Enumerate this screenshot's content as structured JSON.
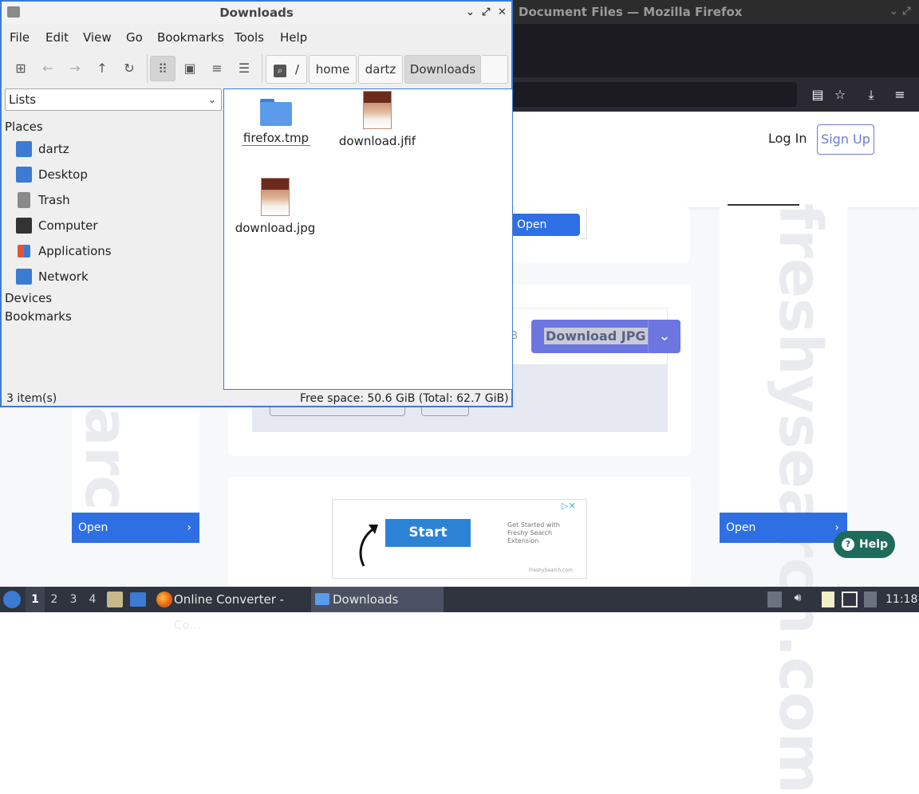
{
  "firefox": {
    "window_title": "Document Files — Mozilla Firefox",
    "controls": {
      "minimize": "⌄",
      "maximize": "⤢",
      "close": "✕"
    },
    "toolbar_icons": [
      "reader-view-icon",
      "bookmark-star-icon",
      "downloads-icon",
      "menu-icon"
    ],
    "toolbar_glyphs": {
      "reader": "▤",
      "star": "☆",
      "download": "⤓",
      "menu": "≡"
    },
    "header": {
      "login": "Log In",
      "signup": "Sign Up"
    },
    "converter": {
      "download_label": "Download JPG",
      "dropdown_glyph": "⌄",
      "size_fragment": "B"
    },
    "open_buttons": {
      "label": "Open",
      "chevron": "›"
    },
    "freshy_ad": {
      "start": "Start",
      "text": "Get Started with Freshy Search Extension",
      "url": "FreshySearch.com",
      "close": "▷✕"
    },
    "watermark": "freshysearch.com",
    "watermark_left": "arch.com",
    "help": {
      "label": "Help",
      "glyph": "?"
    }
  },
  "file_manager": {
    "title": "Downloads",
    "controls": {
      "minimize": "⌄",
      "maximize": "⤢",
      "close": "✕"
    },
    "menu": [
      "File",
      "Edit",
      "View",
      "Go",
      "Bookmarks",
      "Tools",
      "Help"
    ],
    "toolbar": {
      "new_tab": "⊞",
      "back": "←",
      "forward": "→",
      "up": "↑",
      "reload": "↻",
      "icon_view": "⠿",
      "thumb_view": "▣",
      "compact_view": "≡",
      "list_view": "☰"
    },
    "breadcrumbs": {
      "root_glyph": "⌕",
      "root": "/",
      "items": [
        "home",
        "dartz",
        "Downloads"
      ]
    },
    "sidebar": {
      "selector": "Lists",
      "places_header": "Places",
      "places": [
        {
          "label": "dartz",
          "icon": "home-folder-icon",
          "color": "#3b7bd4"
        },
        {
          "label": "Desktop",
          "icon": "desktop-icon",
          "color": "#3b7bd4"
        },
        {
          "label": "Trash",
          "icon": "trash-icon",
          "color": "#8a8a8a"
        },
        {
          "label": "Computer",
          "icon": "computer-icon",
          "color": "#333333"
        },
        {
          "label": "Applications",
          "icon": "applications-icon",
          "color": "#e0553a"
        },
        {
          "label": "Network",
          "icon": "network-icon",
          "color": "#3b7bd4"
        }
      ],
      "devices_header": "Devices",
      "bookmarks_header": "Bookmarks"
    },
    "files": [
      {
        "name": "firefox.tmp",
        "icon": "folder-icon"
      },
      {
        "name": "download.jfif",
        "icon": "image-thumbnail"
      },
      {
        "name": "download.jpg",
        "icon": "image-thumbnail"
      }
    ],
    "status": {
      "count": "3 item(s)",
      "free_space": "Free space: 50.6 GiB (Total: 62.7 GiB)"
    }
  },
  "taskbar": {
    "workspaces": [
      "1",
      "2",
      "3",
      "4"
    ],
    "tasks": [
      {
        "label": "Online Converter - Co...",
        "icon": "firefox-icon"
      },
      {
        "label": "Downloads",
        "icon": "folder-icon"
      }
    ],
    "clock": "11:18",
    "colors": {
      "bar": "#2f343f",
      "accent": "#3b7bd4"
    }
  }
}
